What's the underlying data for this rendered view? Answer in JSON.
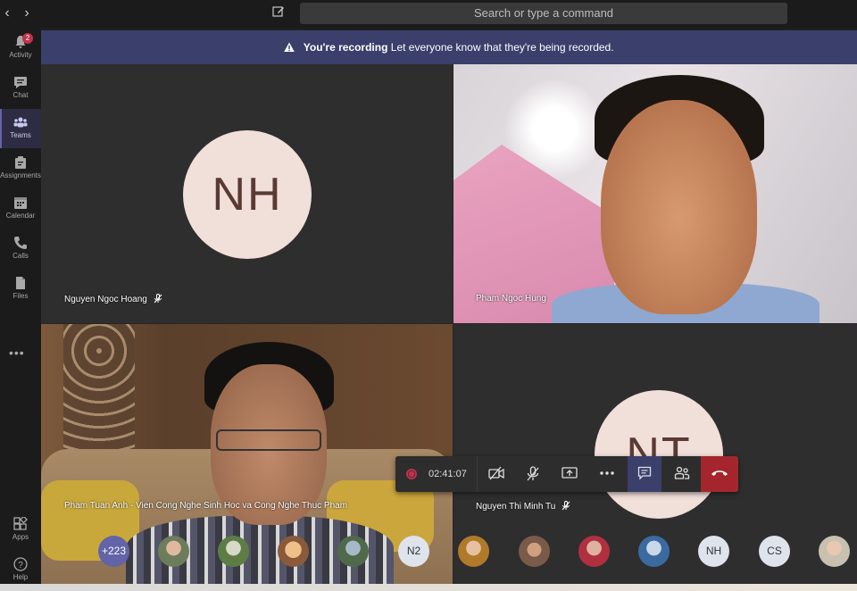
{
  "topbar": {
    "back_label": "‹",
    "forward_label": "›",
    "search_placeholder": "Search or type a command"
  },
  "rail": {
    "items": [
      {
        "label": "Activity",
        "icon": "bell-icon",
        "badge": "2"
      },
      {
        "label": "Chat",
        "icon": "chat-icon"
      },
      {
        "label": "Teams",
        "icon": "teams-icon"
      },
      {
        "label": "Assignments",
        "icon": "assignments-icon"
      },
      {
        "label": "Calendar",
        "icon": "calendar-icon"
      },
      {
        "label": "Calls",
        "icon": "phone-icon"
      },
      {
        "label": "Files",
        "icon": "file-icon"
      },
      {
        "label": "Apps",
        "icon": "apps-icon"
      },
      {
        "label": "Help",
        "icon": "help-icon"
      }
    ],
    "more_label": "•••"
  },
  "banner": {
    "title": "You're recording",
    "message": "Let everyone know that they're being recorded."
  },
  "tiles": [
    {
      "name": "Nguyen Ngoc Hoang",
      "initials": "NH",
      "muted": true
    },
    {
      "name": "Pham Ngoc Hung",
      "muted": false
    },
    {
      "name": "Pham Tuan Anh - Vien Cong Nghe Sinh Hoc va Cong Nghe Thuc Pham",
      "muted": false
    },
    {
      "name": "Nguyen Thi Minh Tu",
      "initials": "NT",
      "muted": true
    }
  ],
  "controls": {
    "timer": "02:41:07",
    "buttons": [
      "camera-off-icon",
      "mic-off-icon",
      "share-screen-icon",
      "more-icon",
      "chat-icon",
      "participants-icon",
      "hang-up-icon"
    ]
  },
  "participants_strip": [
    {
      "type": "more",
      "label": "+223"
    },
    {
      "type": "photo"
    },
    {
      "type": "photo"
    },
    {
      "type": "photo"
    },
    {
      "type": "photo"
    },
    {
      "type": "initials",
      "label": "N2"
    },
    {
      "type": "photo"
    },
    {
      "type": "photo"
    },
    {
      "type": "photo"
    },
    {
      "type": "photo"
    },
    {
      "type": "initials",
      "label": "NH"
    },
    {
      "type": "initials",
      "label": "CS"
    },
    {
      "type": "photo"
    }
  ],
  "colors": {
    "accent": "#6264a7",
    "banner_bg": "#3a3f6b",
    "hangup": "#a4262c",
    "record": "#c4314b",
    "avatar_bg": "#f1dfda",
    "avatar_text": "#5a3b33"
  }
}
